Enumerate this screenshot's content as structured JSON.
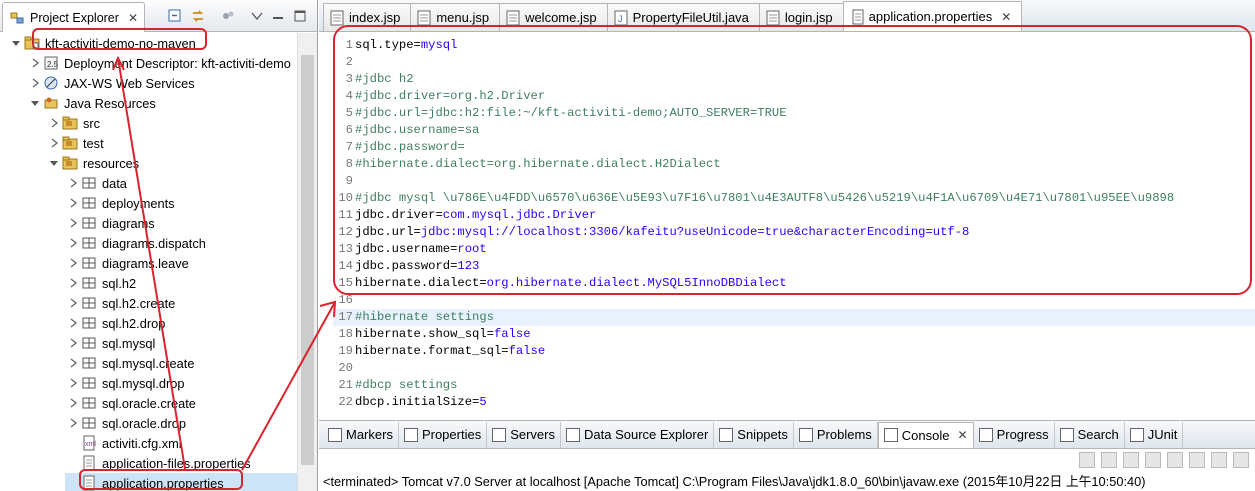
{
  "explorer": {
    "title": "Project Explorer",
    "close": "✕",
    "tree": [
      {
        "label": "kft-activiti-demo-no-maven",
        "depth": 0,
        "twisty": "open",
        "icon": "project-icon",
        "highlight": true
      },
      {
        "label": "Deployment Descriptor: kft-activiti-demo",
        "depth": 1,
        "twisty": "closed",
        "icon": "deployment-descriptor-icon"
      },
      {
        "label": "JAX-WS Web Services",
        "depth": 1,
        "twisty": "closed",
        "icon": "web-services-icon"
      },
      {
        "label": "Java Resources",
        "depth": 1,
        "twisty": "open",
        "icon": "java-resources-icon"
      },
      {
        "label": "src",
        "depth": 2,
        "twisty": "closed",
        "icon": "source-folder-icon"
      },
      {
        "label": "test",
        "depth": 2,
        "twisty": "closed",
        "icon": "source-folder-icon"
      },
      {
        "label": "resources",
        "depth": 2,
        "twisty": "open",
        "icon": "source-folder-icon"
      },
      {
        "label": "data",
        "depth": 3,
        "twisty": "closed",
        "icon": "package-icon"
      },
      {
        "label": "deployments",
        "depth": 3,
        "twisty": "closed",
        "icon": "package-icon"
      },
      {
        "label": "diagrams",
        "depth": 3,
        "twisty": "closed",
        "icon": "package-icon"
      },
      {
        "label": "diagrams.dispatch",
        "depth": 3,
        "twisty": "closed",
        "icon": "package-icon"
      },
      {
        "label": "diagrams.leave",
        "depth": 3,
        "twisty": "closed",
        "icon": "package-icon"
      },
      {
        "label": "sql.h2",
        "depth": 3,
        "twisty": "closed",
        "icon": "package-icon"
      },
      {
        "label": "sql.h2.create",
        "depth": 3,
        "twisty": "closed",
        "icon": "package-icon"
      },
      {
        "label": "sql.h2.drop",
        "depth": 3,
        "twisty": "closed",
        "icon": "package-icon"
      },
      {
        "label": "sql.mysql",
        "depth": 3,
        "twisty": "closed",
        "icon": "package-icon"
      },
      {
        "label": "sql.mysql.create",
        "depth": 3,
        "twisty": "closed",
        "icon": "package-icon"
      },
      {
        "label": "sql.mysql.drop",
        "depth": 3,
        "twisty": "closed",
        "icon": "package-icon"
      },
      {
        "label": "sql.oracle.create",
        "depth": 3,
        "twisty": "closed",
        "icon": "package-icon"
      },
      {
        "label": "sql.oracle.drop",
        "depth": 3,
        "twisty": "closed",
        "icon": "package-icon"
      },
      {
        "label": "activiti.cfg.xml",
        "depth": 3,
        "twisty": "none",
        "icon": "xml-file-icon"
      },
      {
        "label": "application-files.properties",
        "depth": 3,
        "twisty": "none",
        "icon": "properties-file-icon"
      },
      {
        "label": "application.properties",
        "depth": 3,
        "twisty": "none",
        "icon": "properties-file-icon",
        "selected": true,
        "highlight": true
      }
    ]
  },
  "editor": {
    "tabs": [
      {
        "label": "index.jsp",
        "icon": "jsp-file-icon"
      },
      {
        "label": "menu.jsp",
        "icon": "jsp-file-icon"
      },
      {
        "label": "welcome.jsp",
        "icon": "jsp-file-icon"
      },
      {
        "label": "PropertyFileUtil.java",
        "icon": "java-file-icon"
      },
      {
        "label": "login.jsp",
        "icon": "jsp-file-icon"
      },
      {
        "label": "application.properties",
        "icon": "properties-file-icon",
        "active": true,
        "close": "✕"
      }
    ],
    "lines": [
      {
        "n": "1",
        "key": "sql.type=",
        "val": "mysql"
      },
      {
        "n": "2",
        "comment": ""
      },
      {
        "n": "3",
        "comment": "#jdbc h2"
      },
      {
        "n": "4",
        "comment": "#jdbc.driver=org.h2.Driver"
      },
      {
        "n": "5",
        "comment": "#jdbc.url=jdbc:h2:file:~/kft-activiti-demo;AUTO_SERVER=TRUE"
      },
      {
        "n": "6",
        "comment": "#jdbc.username=sa"
      },
      {
        "n": "7",
        "comment": "#jdbc.password="
      },
      {
        "n": "8",
        "comment": "#hibernate.dialect=org.hibernate.dialect.H2Dialect"
      },
      {
        "n": "9",
        "comment": ""
      },
      {
        "n": "10",
        "comment": "#jdbc mysql \\u786E\\u4FDD\\u6570\\u636E\\u5E93\\u7F16\\u7801\\u4E3AUTF8\\u5426\\u5219\\u4F1A\\u6709\\u4E71\\u7801\\u95EE\\u9898"
      },
      {
        "n": "11",
        "key": "jdbc.driver=",
        "val": "com.mysql.jdbc.Driver"
      },
      {
        "n": "12",
        "key": "jdbc.url=",
        "val": "jdbc:mysql://localhost:3306/kafeitu?useUnicode=true&characterEncoding=utf-8"
      },
      {
        "n": "13",
        "key": "jdbc.username=",
        "val": "root"
      },
      {
        "n": "14",
        "key": "jdbc.password=",
        "val": "123"
      },
      {
        "n": "15",
        "key": "hibernate.dialect=",
        "val": "org.hibernate.dialect.MySQL5InnoDBDialect"
      },
      {
        "n": "16",
        "comment": ""
      },
      {
        "n": "17",
        "comment": "#hibernate settings",
        "current": true
      },
      {
        "n": "18",
        "key": "hibernate.show_sql=",
        "val": "false"
      },
      {
        "n": "19",
        "key": "hibernate.format_sql=",
        "val": "false"
      },
      {
        "n": "20",
        "comment": ""
      },
      {
        "n": "21",
        "comment": "#dbcp settings"
      },
      {
        "n": "22",
        "key": "dbcp.initialSize=",
        "val": "5"
      }
    ]
  },
  "bottom": {
    "tabs": [
      {
        "label": "Markers",
        "icon": "markers-icon"
      },
      {
        "label": "Properties",
        "icon": "properties-icon"
      },
      {
        "label": "Servers",
        "icon": "servers-icon"
      },
      {
        "label": "Data Source Explorer",
        "icon": "data-source-icon"
      },
      {
        "label": "Snippets",
        "icon": "snippets-icon"
      },
      {
        "label": "Problems",
        "icon": "problems-icon"
      },
      {
        "label": "Console",
        "icon": "console-icon",
        "active": true,
        "close": "✕"
      },
      {
        "label": "Progress",
        "icon": "progress-icon"
      },
      {
        "label": "Search",
        "icon": "search-icon"
      },
      {
        "label": "JUnit",
        "icon": "junit-icon"
      }
    ],
    "console_status": "<terminated> Tomcat v7.0 Server at localhost [Apache Tomcat] C:\\Program Files\\Java\\jdk1.8.0_60\\bin\\javaw.exe (2015年10月22日 上午10:50:40)"
  },
  "colors": {
    "annotation": "#d9232d",
    "comment": "#3f7f5f",
    "value": "#2a00ff",
    "selection": "#cde4f7"
  }
}
